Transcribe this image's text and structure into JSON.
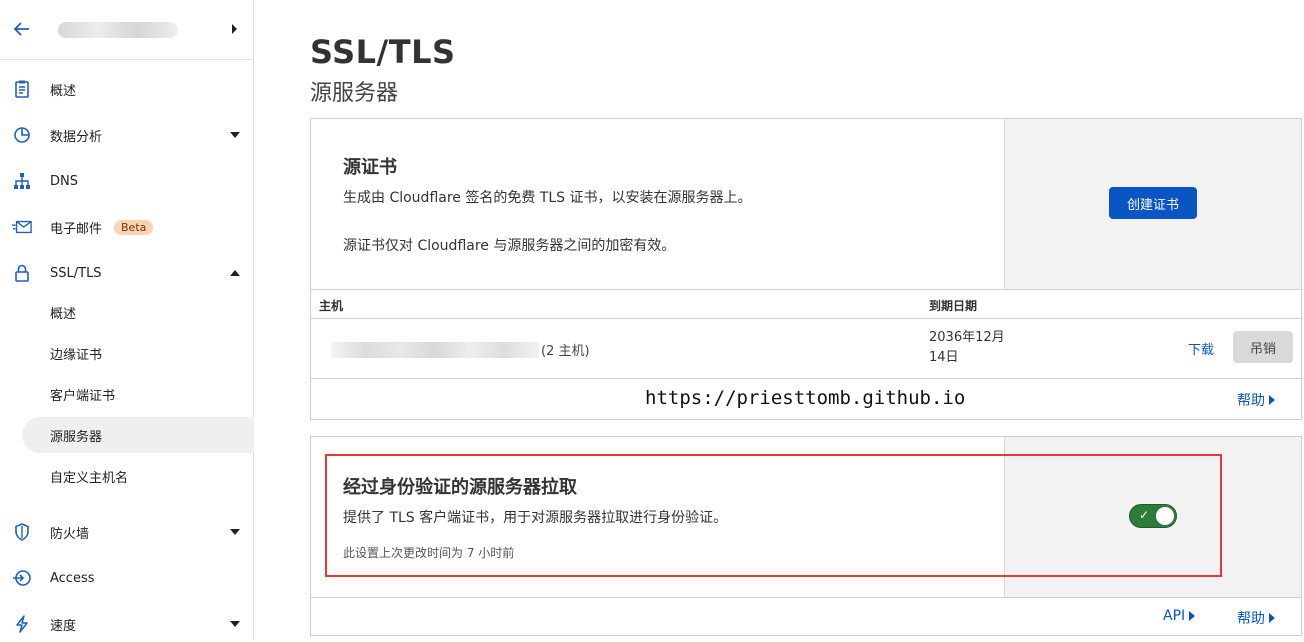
{
  "sidebar": {
    "items": [
      {
        "label": "概述"
      },
      {
        "label": "数据分析"
      },
      {
        "label": "DNS"
      },
      {
        "label": "电子邮件"
      },
      {
        "label": "SSL/TLS"
      },
      {
        "label": "防火墙"
      },
      {
        "label": "Access"
      },
      {
        "label": "速度"
      }
    ],
    "beta_badge": "Beta",
    "ssl_subitems": [
      {
        "label": "概述"
      },
      {
        "label": "边缘证书"
      },
      {
        "label": "客户端证书"
      },
      {
        "label": "源服务器"
      },
      {
        "label": "自定义主机名"
      }
    ]
  },
  "page": {
    "title": "SSL/TLS",
    "subtitle": "源服务器"
  },
  "origin_cert": {
    "heading": "源证书",
    "desc1": "生成由 Cloudflare 签名的免费 TLS 证书，以安装在源服务器上。",
    "desc2": "源证书仅对 Cloudflare 与源服务器之间的加密有效。",
    "create_button": "创建证书",
    "table": {
      "col_host": "主机",
      "col_expiry": "到期日期",
      "rows": [
        {
          "host_count": "(2 主机)",
          "expiry": "2036年12月14日",
          "download": "下载",
          "revoke": "吊销"
        }
      ]
    },
    "help": "帮助"
  },
  "watermark": "https://priesttomb.github.io",
  "auth_pull": {
    "heading": "经过身份验证的源服务器拉取",
    "desc": "提供了 TLS 客户端证书，用于对源服务器拉取进行身份验证。",
    "last_changed": "此设置上次更改时间为 7 小时前",
    "toggle_on": true,
    "api_link": "API",
    "help": "帮助"
  },
  "colors": {
    "primary": "#0a55c4",
    "toggle_on": "#2d7d3a",
    "highlight_border": "#e53935",
    "beta_bg": "#fbd3b0"
  }
}
